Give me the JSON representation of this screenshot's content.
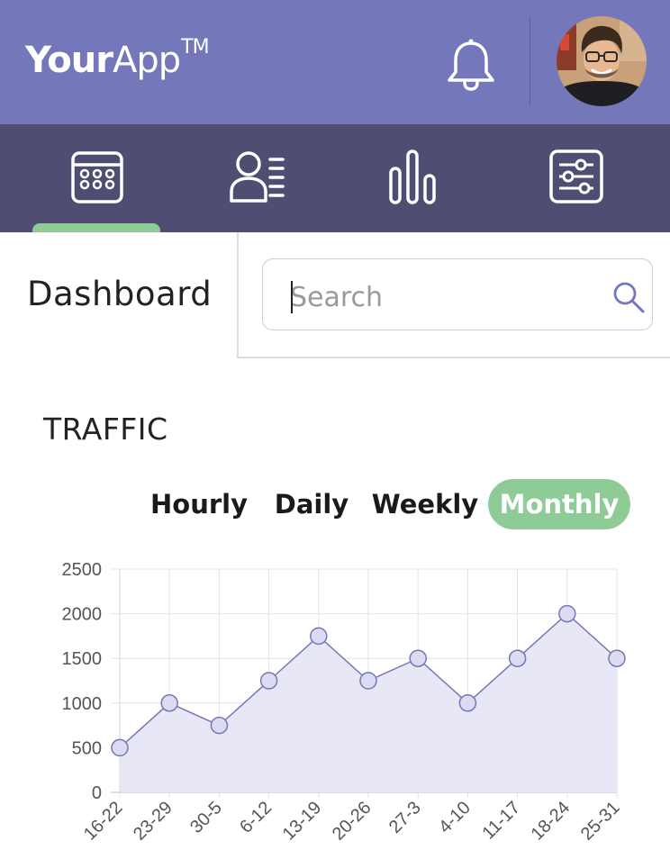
{
  "header": {
    "logo_bold": "Your",
    "logo_regular": "App",
    "logo_tm": "TM",
    "notification_icon": "bell-icon",
    "avatar_icon": "user-avatar"
  },
  "nav": {
    "items": [
      {
        "icon": "calendar-icon",
        "active": true
      },
      {
        "icon": "contacts-list-icon",
        "active": false
      },
      {
        "icon": "bar-chart-icon",
        "active": false
      },
      {
        "icon": "sliders-icon",
        "active": false
      }
    ],
    "active_color": "#8ecb97"
  },
  "page": {
    "title": "Dashboard"
  },
  "search": {
    "placeholder": "Search",
    "value": "",
    "icon": "search-icon"
  },
  "card": {
    "title": "TRAFFIC",
    "tabs": [
      {
        "label": "Hourly",
        "active": false
      },
      {
        "label": "Daily",
        "active": false
      },
      {
        "label": "Weekly",
        "active": false
      },
      {
        "label": "Monthly",
        "active": true
      }
    ]
  },
  "colors": {
    "header_bg": "#7477b9",
    "nav_bg": "#4f4e72",
    "accent_green": "#8ecb97",
    "line": "#7477b9",
    "fill": "#e4e4f4"
  },
  "chart_data": {
    "type": "area",
    "categories": [
      "16-22",
      "23-29",
      "30-5",
      "6-12",
      "13-19",
      "20-26",
      "27-3",
      "4-10",
      "11-17",
      "18-24",
      "25-31"
    ],
    "values": [
      500,
      1000,
      750,
      1250,
      1750,
      1250,
      1500,
      1000,
      1500,
      2000,
      1500
    ],
    "y_ticks": [
      "0",
      "500",
      "1000",
      "1500",
      "2000",
      "2500"
    ],
    "ylim": [
      0,
      2500
    ],
    "grid": true
  }
}
